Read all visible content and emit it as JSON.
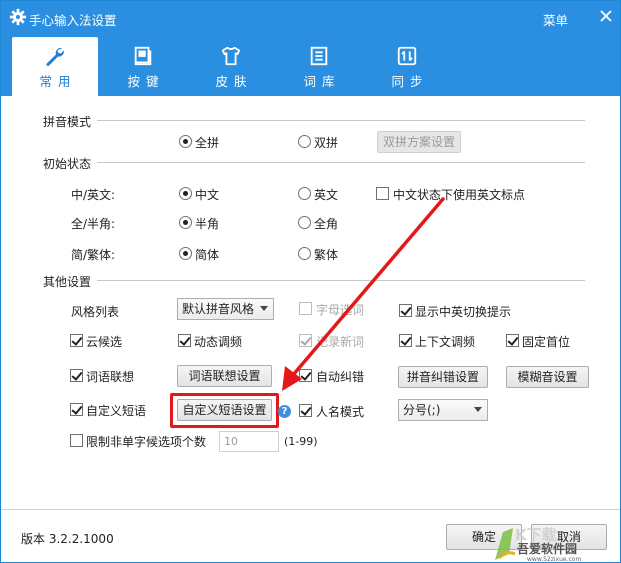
{
  "window": {
    "title": "手心输入法设置",
    "menu_label": "菜单"
  },
  "tabs": [
    {
      "label": "常用",
      "icon": "wrench-icon",
      "active": true
    },
    {
      "label": "按键",
      "icon": "keyboard-icon",
      "active": false
    },
    {
      "label": "皮肤",
      "icon": "shirt-icon",
      "active": false
    },
    {
      "label": "词库",
      "icon": "document-icon",
      "active": false
    },
    {
      "label": "同步",
      "icon": "sync-icon",
      "active": false
    }
  ],
  "pinyin": {
    "title": "拼音模式",
    "full": "全拼",
    "double": "双拼",
    "double_settings": "双拼方案设置",
    "selected": "全拼"
  },
  "initial": {
    "title": "初始状态",
    "lang_label": "中/英文:",
    "lang_cn": "中文",
    "lang_en": "英文",
    "cn_use_en_punct": "中文状态下使用英文标点",
    "width_label": "全/半角:",
    "half": "半角",
    "full": "全角",
    "script_label": "简/繁体:",
    "simplified": "简体",
    "traditional": "繁体"
  },
  "other": {
    "title": "其他设置",
    "style_label": "风格列表",
    "style_value": "默认拼音风格",
    "letter_select": "字母选词",
    "show_switch_hint": "显示中英切换提示",
    "cloud": "云候选",
    "dynamic_freq": "动态调频",
    "record_new": "记录新词",
    "context_freq": "上下文调频",
    "fixed_first": "固定首位",
    "association": "词语联想",
    "association_settings": "词语联想设置",
    "auto_correct": "自动纠错",
    "pinyin_correct_settings": "拼音纠错设置",
    "fuzzy_settings": "模糊音设置",
    "custom_phrase": "自定义短语",
    "custom_phrase_settings": "自定义短语设置",
    "name_mode": "人名模式",
    "page_key_value": "分号(;)",
    "limit_label": "限制非单字候选项个数",
    "limit_value": "10",
    "limit_range": "(1-99)"
  },
  "footer": {
    "version": "版本 3.2.2.1000",
    "ok": "确定",
    "cancel": "取消"
  },
  "watermark": {
    "logo_text": "K下载",
    "brand": "吾爱软件园",
    "url": "www.52zixue.com"
  },
  "colors": {
    "accent": "#2a8fe0",
    "highlight": "#e4181b"
  }
}
